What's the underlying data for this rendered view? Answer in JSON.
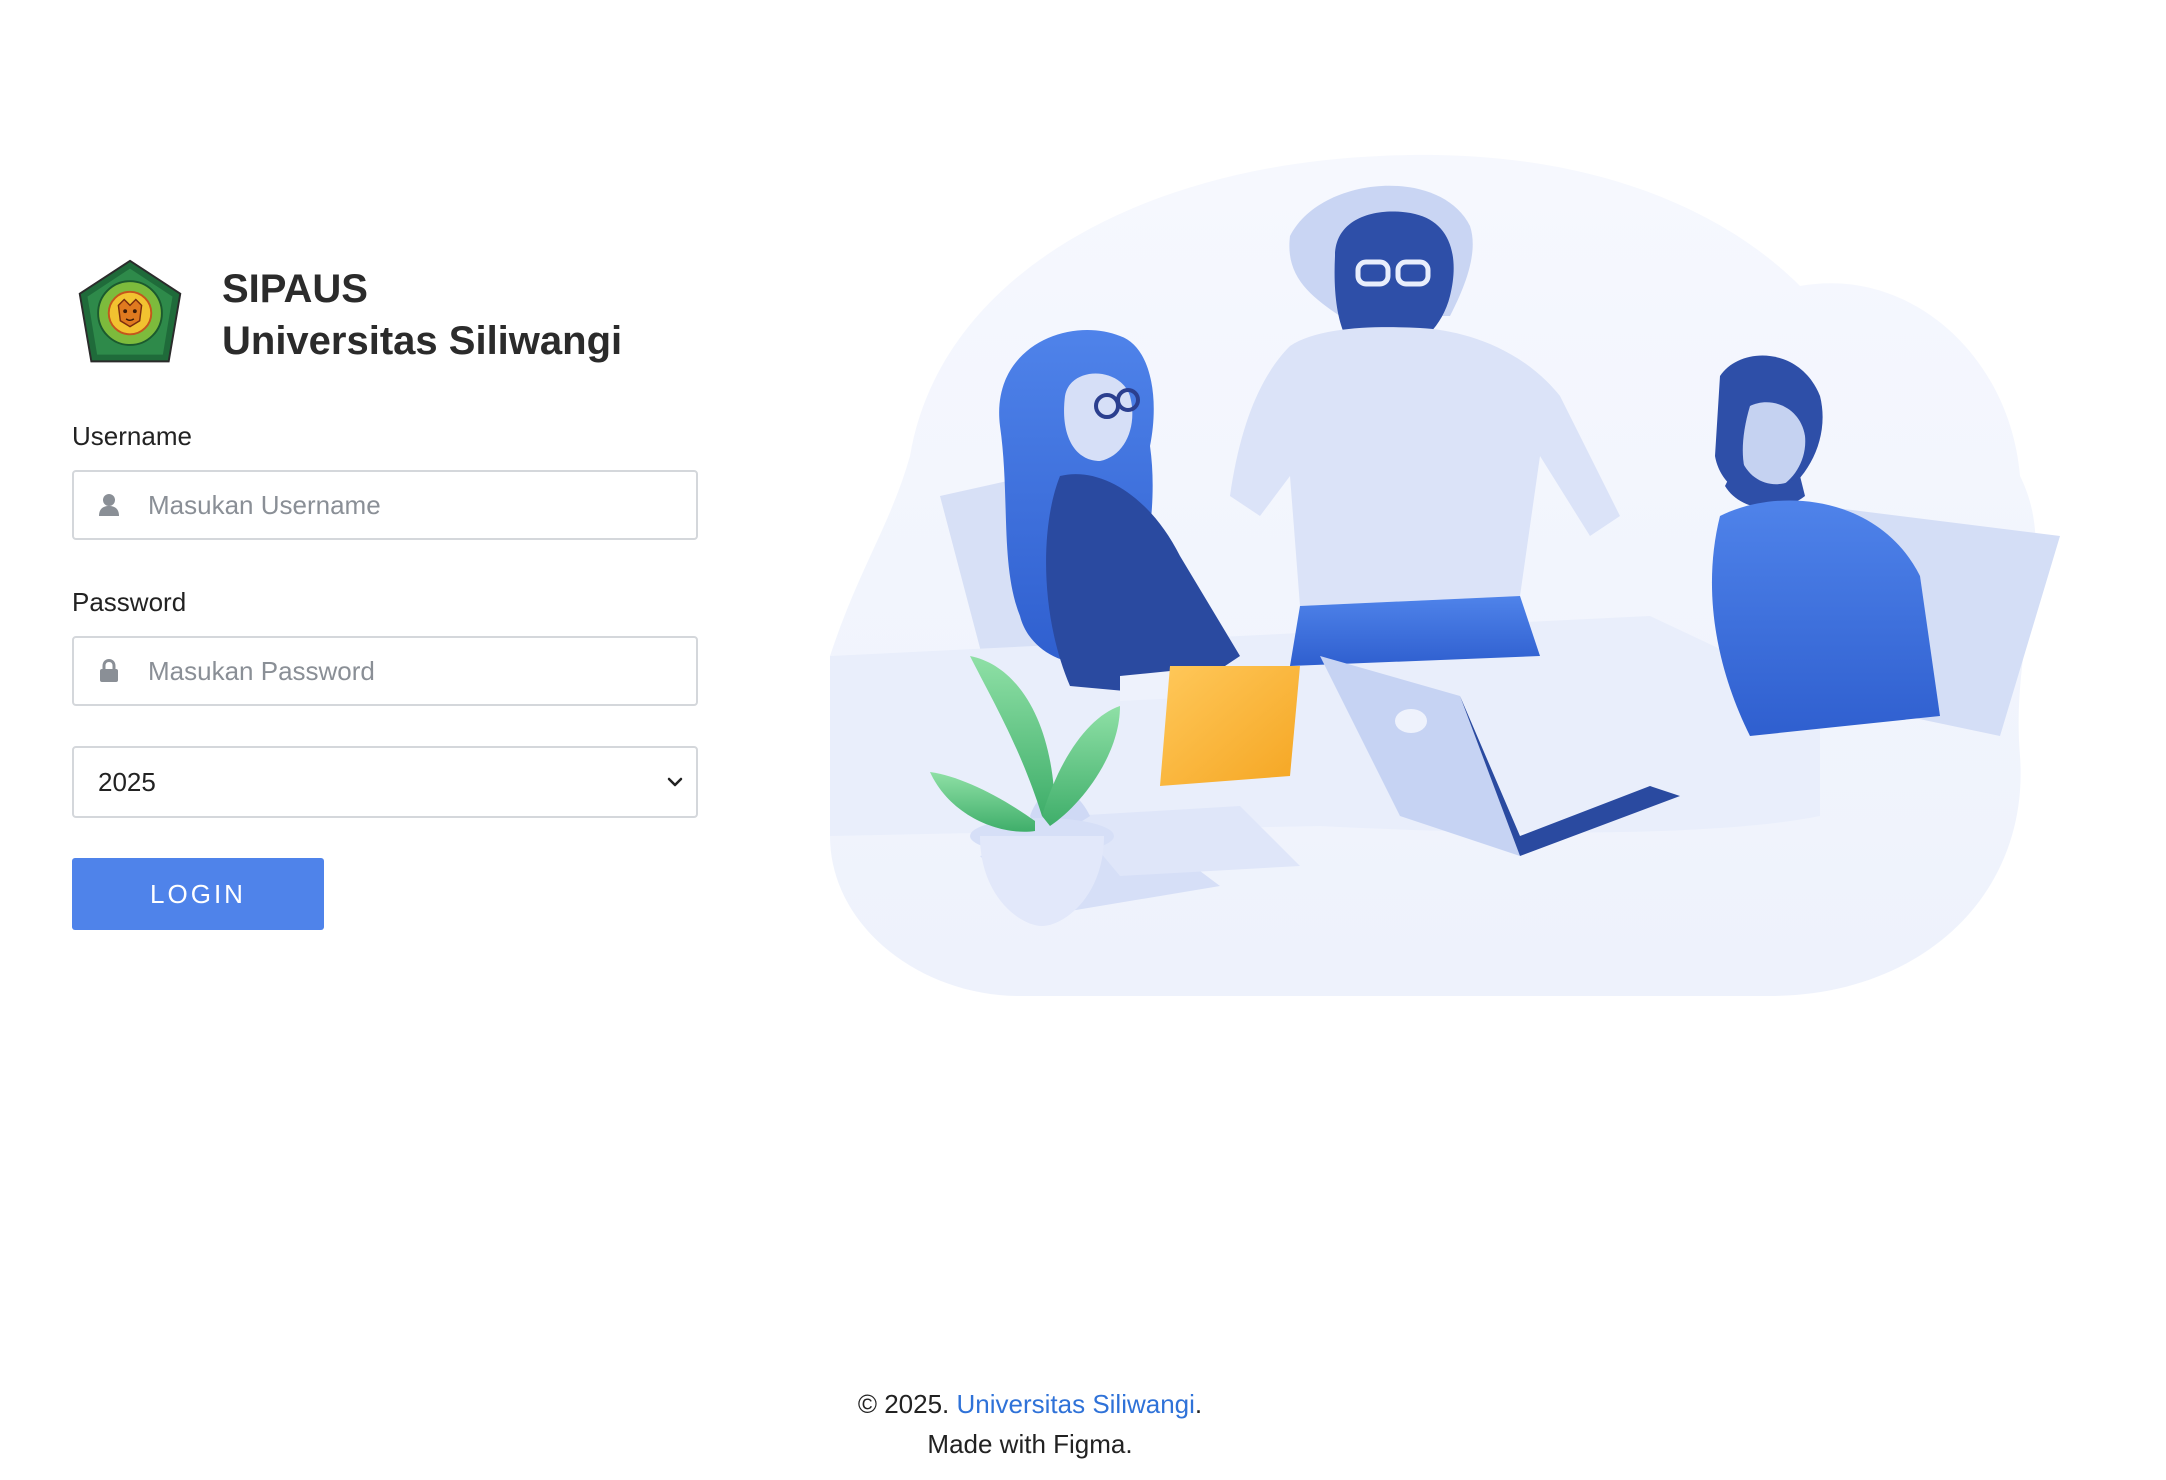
{
  "brand": {
    "line1": "SIPAUS",
    "line2": "Universitas Siliwangi",
    "logo_icon": "university-seal-logo",
    "logo_colors": {
      "outer": "#1f6b3a",
      "inner": "#7dbb3c",
      "center": "#f2c230"
    }
  },
  "form": {
    "username": {
      "label": "Username",
      "placeholder": "Masukan Username",
      "icon": "user-icon"
    },
    "password": {
      "label": "Password",
      "placeholder": "Masukan Password",
      "icon": "lock-icon"
    },
    "year_select": {
      "selected": "2025",
      "icon": "chevron-down-icon"
    },
    "login_button": "LOGIN"
  },
  "footer": {
    "prefix": "© 2025. ",
    "link_text": "Universitas Siliwangi",
    "suffix": ".",
    "line2": "Made with Figma."
  },
  "colors": {
    "accent": "#4f83ea",
    "link": "#2f72d8",
    "border": "#d4d7db",
    "placeholder": "#8a8f96"
  }
}
